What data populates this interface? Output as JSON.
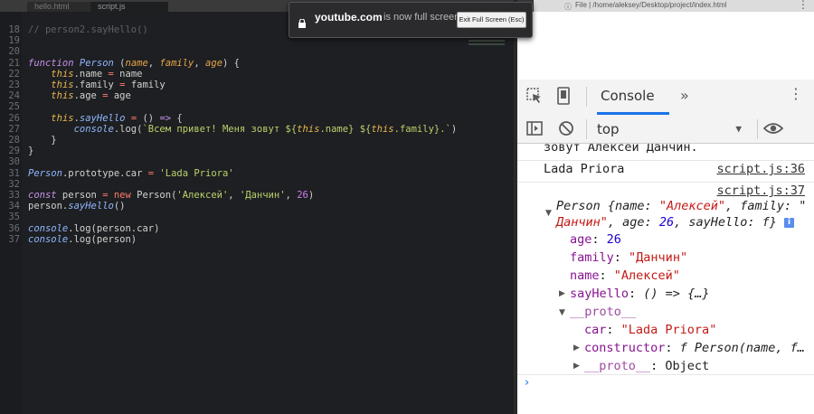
{
  "editor": {
    "tabs": [
      "hello.html",
      "script.js"
    ],
    "lines": [
      {
        "num": "18",
        "tokens": [
          {
            "t": "// person2.sayHello()",
            "c": "cmt"
          }
        ]
      },
      {
        "num": "19",
        "tokens": []
      },
      {
        "num": "20",
        "tokens": []
      },
      {
        "num": "21",
        "tokens": [
          {
            "t": "function ",
            "c": "kw"
          },
          {
            "t": "Person",
            "c": "fn"
          },
          {
            "t": " (",
            "c": ""
          },
          {
            "t": "name",
            "c": "param"
          },
          {
            "t": ", ",
            "c": ""
          },
          {
            "t": "family",
            "c": "param"
          },
          {
            "t": ", ",
            "c": ""
          },
          {
            "t": "age",
            "c": "param"
          },
          {
            "t": ") {",
            "c": ""
          }
        ]
      },
      {
        "num": "22",
        "tokens": [
          {
            "t": "    ",
            "c": ""
          },
          {
            "t": "this",
            "c": "this"
          },
          {
            "t": ".name ",
            "c": ""
          },
          {
            "t": "=",
            "c": "op"
          },
          {
            "t": " name",
            "c": ""
          }
        ]
      },
      {
        "num": "23",
        "tokens": [
          {
            "t": "    ",
            "c": ""
          },
          {
            "t": "this",
            "c": "this"
          },
          {
            "t": ".family ",
            "c": ""
          },
          {
            "t": "=",
            "c": "op"
          },
          {
            "t": " family",
            "c": ""
          }
        ]
      },
      {
        "num": "24",
        "tokens": [
          {
            "t": "    ",
            "c": ""
          },
          {
            "t": "this",
            "c": "this"
          },
          {
            "t": ".age ",
            "c": ""
          },
          {
            "t": "=",
            "c": "op"
          },
          {
            "t": " age",
            "c": ""
          }
        ]
      },
      {
        "num": "25",
        "tokens": []
      },
      {
        "num": "26",
        "tokens": [
          {
            "t": "    ",
            "c": ""
          },
          {
            "t": "this",
            "c": "this"
          },
          {
            "t": ".",
            "c": ""
          },
          {
            "t": "sayHello",
            "c": "fn"
          },
          {
            "t": " ",
            "c": ""
          },
          {
            "t": "=",
            "c": "op"
          },
          {
            "t": " () ",
            "c": ""
          },
          {
            "t": "=>",
            "c": "kw"
          },
          {
            "t": " {",
            "c": ""
          }
        ]
      },
      {
        "num": "27",
        "tokens": [
          {
            "t": "        ",
            "c": ""
          },
          {
            "t": "console",
            "c": "fn"
          },
          {
            "t": ".log(",
            "c": ""
          },
          {
            "t": "`Всем привет! Меня зовут ${",
            "c": "str"
          },
          {
            "t": "this",
            "c": "this"
          },
          {
            "t": ".name",
            "c": "str"
          },
          {
            "t": "} ${",
            "c": "str"
          },
          {
            "t": "this",
            "c": "this"
          },
          {
            "t": ".family",
            "c": "str"
          },
          {
            "t": "}.`",
            "c": "str"
          },
          {
            "t": ")",
            "c": ""
          }
        ]
      },
      {
        "num": "28",
        "tokens": [
          {
            "t": "    }",
            "c": ""
          }
        ]
      },
      {
        "num": "29",
        "tokens": [
          {
            "t": "}",
            "c": ""
          }
        ]
      },
      {
        "num": "30",
        "tokens": []
      },
      {
        "num": "31",
        "tokens": [
          {
            "t": "Person",
            "c": "fn"
          },
          {
            "t": ".prototype.car ",
            "c": ""
          },
          {
            "t": "=",
            "c": "op"
          },
          {
            "t": " ",
            "c": ""
          },
          {
            "t": "'Lada Priora'",
            "c": "str"
          }
        ]
      },
      {
        "num": "32",
        "tokens": []
      },
      {
        "num": "33",
        "tokens": [
          {
            "t": "const",
            "c": "kw"
          },
          {
            "t": " person ",
            "c": ""
          },
          {
            "t": "=",
            "c": "op"
          },
          {
            "t": " ",
            "c": ""
          },
          {
            "t": "new",
            "c": "op"
          },
          {
            "t": " Person(",
            "c": ""
          },
          {
            "t": "'Алексей'",
            "c": "str"
          },
          {
            "t": ", ",
            "c": ""
          },
          {
            "t": "'Данчин'",
            "c": "str"
          },
          {
            "t": ", ",
            "c": ""
          },
          {
            "t": "26",
            "c": "num"
          },
          {
            "t": ")",
            "c": ""
          }
        ]
      },
      {
        "num": "34",
        "tokens": [
          {
            "t": "person.",
            "c": ""
          },
          {
            "t": "sayHello",
            "c": "fn"
          },
          {
            "t": "()",
            "c": ""
          }
        ]
      },
      {
        "num": "35",
        "tokens": []
      },
      {
        "num": "36",
        "tokens": [
          {
            "t": "console",
            "c": "fn"
          },
          {
            "t": ".log(person.car)",
            "c": ""
          }
        ]
      },
      {
        "num": "37",
        "tokens": [
          {
            "t": "console",
            "c": "fn"
          },
          {
            "t": ".log(person)",
            "c": ""
          }
        ]
      }
    ]
  },
  "browser": {
    "url": "File | /home/aleksey/Desktop/project/index.html"
  },
  "fullscreen_notice": {
    "site": "youtube.com",
    "message": "is now full screen",
    "exit_label": "Exit Full Screen (Esc)"
  },
  "devtools": {
    "tab_label": "Console",
    "more_tabs": "»",
    "context": "top",
    "console": {
      "line_partial": "зовут Алексей Данчин.",
      "log1_text": "Lada Priora",
      "log1_src": "script.js:36",
      "log2_src": "script.js:37",
      "obj_summary_1a": "Person {",
      "obj_summary_1b": "name: ",
      "obj_summary_1c": "\"Алексей\"",
      "obj_summary_1d": ", family: \"",
      "obj_summary_2a": "Данчин\"",
      "obj_summary_2b": ", age: ",
      "obj_summary_2c": "26",
      "obj_summary_2d": ", sayHello: ",
      "obj_summary_2e": "f",
      "obj_summary_2f": "}",
      "info_badge": "i",
      "age_key": "age",
      "age_val": "26",
      "family_key": "family",
      "family_val": "\"Данчин\"",
      "name_key": "name",
      "name_val": "\"Алексей\"",
      "sayhello_key": "sayHello",
      "sayhello_val": "() => {…}",
      "proto_key": "__proto__",
      "car_key": "car",
      "car_val": "\"Lada Priora\"",
      "constructor_key": "constructor",
      "constructor_val": "f Person(name, f…",
      "proto2_key": "__proto__",
      "proto2_val": "Object",
      "prompt": "›"
    }
  }
}
